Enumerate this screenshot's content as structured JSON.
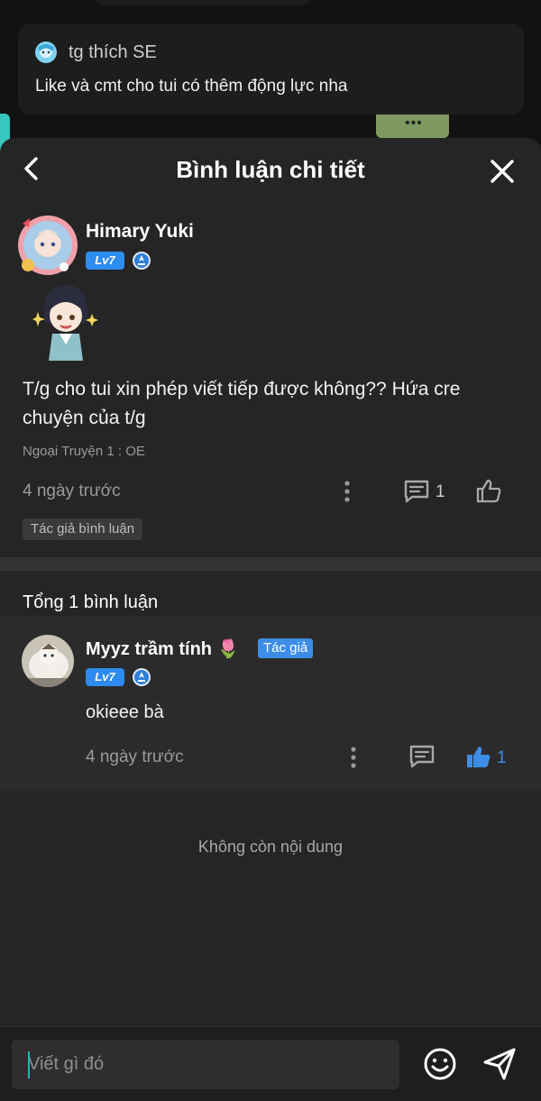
{
  "notice": {
    "author": "tg thích SE",
    "text": "Like và cmt cho tui có thêm động lực nha",
    "more_label": "•••"
  },
  "header": {
    "title": "Bình luận chi tiết"
  },
  "comment": {
    "user_name": "Himary Yuki",
    "level": "Lv7",
    "text": "T/g cho tui xin phép viết tiếp được không?? Hứa cre chuyện của t/g",
    "chapter": "Ngoại Truyện 1 : OE",
    "time": "4 ngày trước",
    "reply_count": "1",
    "tag": "Tác giả bình luận"
  },
  "replies": {
    "total_label": "Tổng 1 bình luận",
    "items": [
      {
        "user_name": "Myyz trầm tính 🌷",
        "author_badge": "Tác giả",
        "level": "Lv7",
        "text": "okieee bà",
        "time": "4 ngày trước",
        "like_count": "1"
      }
    ]
  },
  "end_text": "Không còn nội dung",
  "composer": {
    "placeholder": "Viết gì đó"
  },
  "colors": {
    "accent": "#2e8cf0",
    "like_active": "#3d8de8",
    "cursor": "#1fb8b0"
  },
  "icons": [
    "back-icon",
    "close-icon",
    "rank-icon",
    "kebab-menu-icon",
    "reply-icon",
    "like-icon",
    "emoji-icon",
    "send-icon"
  ]
}
